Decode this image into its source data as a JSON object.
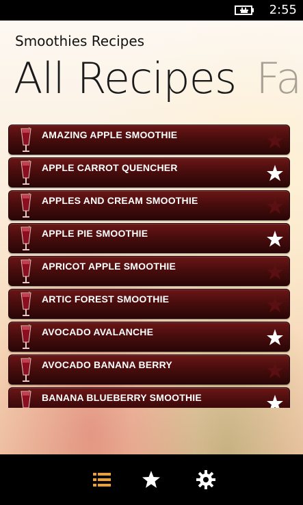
{
  "status": {
    "time": "2:55",
    "battery_icon": "battery-charging-icon"
  },
  "app": {
    "title": "Smoothies Recipes"
  },
  "pivot": {
    "items": [
      "All Recipes",
      "Favorites"
    ],
    "active": "All Recipes"
  },
  "recipes": [
    {
      "name": "AMAZING APPLE SMOOTHIE",
      "favorite": false
    },
    {
      "name": "APPLE CARROT QUENCHER",
      "favorite": true
    },
    {
      "name": "APPLES AND CREAM SMOOTHIE",
      "favorite": false
    },
    {
      "name": "APPLE PIE SMOOTHIE",
      "favorite": true
    },
    {
      "name": "APRICOT APPLE SMOOTHIE",
      "favorite": false
    },
    {
      "name": "ARTIC FOREST SMOOTHIE",
      "favorite": false
    },
    {
      "name": "AVOCADO AVALANCHE",
      "favorite": true
    },
    {
      "name": "AVOCADO BANANA BERRY",
      "favorite": false
    },
    {
      "name": "BANANA BLUEBERRY SMOOTHIE",
      "favorite": true
    }
  ],
  "app_bar": {
    "buttons": [
      {
        "icon": "list-icon",
        "color": "#f0a030"
      },
      {
        "icon": "star-icon",
        "color": "#ffffff"
      },
      {
        "icon": "gear-icon",
        "color": "#ffffff"
      }
    ]
  },
  "colors": {
    "list_item": "#4a0d0d",
    "favorite_star": "#ffffff",
    "unfavorite_star": "#5a1010",
    "accent": "#f0a030"
  }
}
